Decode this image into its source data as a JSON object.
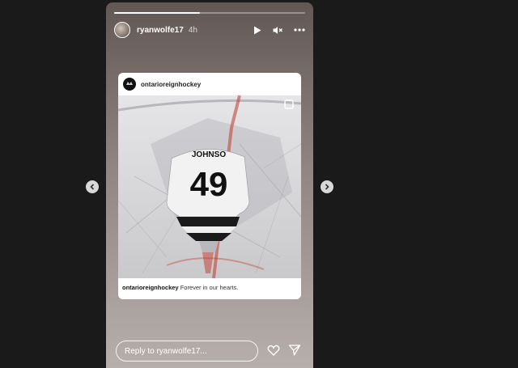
{
  "story": {
    "username": "ryanwolfe17",
    "time": "4h",
    "progress": 0.45
  },
  "post": {
    "account": "ontarioreignhockey",
    "caption_user": "ontarioreignhockey",
    "caption_text": "Forever in our hearts.",
    "jersey_name": "JOHNSO",
    "jersey_number": "49"
  },
  "reply": {
    "placeholder": "Reply to ryanwolfe17..."
  },
  "icons": {
    "play": "play-icon",
    "mute": "speaker-muted-icon",
    "more": "more-options-icon",
    "like": "heart-icon",
    "share": "send-icon",
    "prev": "chevron-left-icon",
    "next": "chevron-right-icon"
  }
}
